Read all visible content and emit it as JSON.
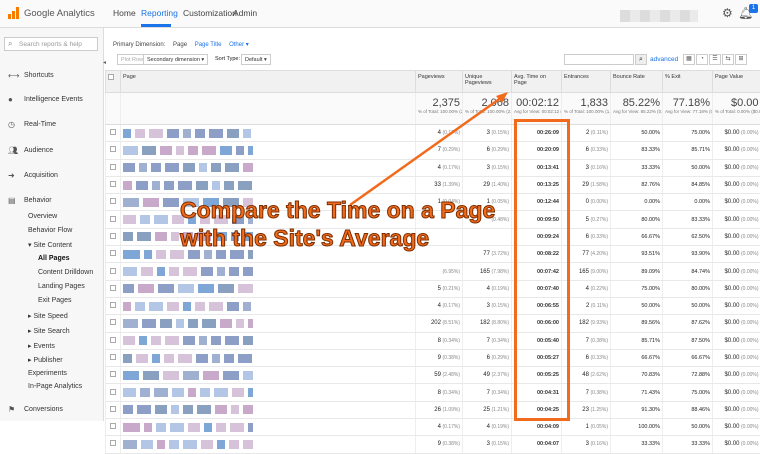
{
  "topbar": {
    "app_name": "Google Analytics",
    "tabs": [
      "Home",
      "Reporting",
      "Customization",
      "Admin"
    ],
    "active_tab": "Reporting",
    "notification_count": "1"
  },
  "sidebar": {
    "search_placeholder": "Search reports & help",
    "items": [
      {
        "label": "Shortcuts",
        "icon": "arrow-icon"
      },
      {
        "label": "Intelligence Events",
        "icon": "bulb-icon"
      },
      {
        "label": "Real-Time",
        "icon": "clock-icon"
      },
      {
        "label": "Audience",
        "icon": "people-icon"
      },
      {
        "label": "Acquisition",
        "icon": "acquisition-icon"
      },
      {
        "label": "Behavior",
        "icon": "behavior-icon"
      }
    ],
    "behavior_sub": [
      "Overview",
      "Behavior Flow",
      "▾ Site Content",
      "All Pages",
      "Content Drilldown",
      "Landing Pages",
      "Exit Pages",
      "▸ Site Speed",
      "▸ Site Search",
      "▸ Events",
      "▸ Publisher",
      "Experiments",
      "In-Page Analytics"
    ],
    "conversions": "Conversions"
  },
  "main": {
    "primary_dimension_label": "Primary Dimension:",
    "dim_page": "Page",
    "dim_page_title": "Page Title",
    "dim_other": "Other ▾",
    "plot_rows": "Plot Rows",
    "secondary_dimension": "Secondary dimension ▾",
    "sort_type_label": "Sort Type:",
    "sort_type": "Default ▾",
    "advanced": "advanced",
    "columns": [
      "",
      "Page",
      "Pageviews",
      "Unique Pageviews",
      "Avg. Time on Page",
      "Entrances",
      "Bounce Rate",
      "% Exit",
      "Page Value"
    ],
    "totals": {
      "pageviews": "2,375",
      "pageviews_sub": "% of Total: 100.00% (2,375)",
      "unique": "2,068",
      "unique_sub": "% of Total: 100.00% (2,068)",
      "avg_time": "00:02:12",
      "avg_time_sub": "Avg for View: 00:02:12 (0.00%)",
      "entrances": "1,833",
      "entrances_sub": "% of Total: 100.00% (1,833)",
      "bounce": "85.22%",
      "bounce_sub": "Avg for View: 85.22% (0.00%)",
      "exit": "77.18%",
      "exit_sub": "Avg for View: 77.18% (0.00%)",
      "value": "$0.00",
      "value_sub": "% of Total: 0.00% ($0.00)"
    },
    "rows": [
      {
        "pv": "4",
        "pvp": "(0.17%)",
        "u": "3",
        "up": "(0.15%)",
        "t": "00:26:09",
        "e": "2",
        "ep": "(0.11%)",
        "b": "50.00%",
        "x": "75.00%",
        "v": "$0.00",
        "vp": "(0.00%)"
      },
      {
        "pv": "7",
        "pvp": "(0.29%)",
        "u": "6",
        "up": "(0.29%)",
        "t": "00:20:09",
        "e": "6",
        "ep": "(0.33%)",
        "b": "83.33%",
        "x": "85.71%",
        "v": "$0.00",
        "vp": "(0.00%)"
      },
      {
        "pv": "4",
        "pvp": "(0.17%)",
        "u": "3",
        "up": "(0.15%)",
        "t": "00:13:41",
        "e": "3",
        "ep": "(0.16%)",
        "b": "33.33%",
        "x": "50.00%",
        "v": "$0.00",
        "vp": "(0.00%)"
      },
      {
        "pv": "33",
        "pvp": "(1.39%)",
        "u": "29",
        "up": "(1.40%)",
        "t": "00:13:25",
        "e": "29",
        "ep": "(1.58%)",
        "b": "82.76%",
        "x": "84.85%",
        "v": "$0.00",
        "vp": "(0.00%)"
      },
      {
        "pv": "1",
        "pvp": "(0.04%)",
        "u": "1",
        "up": "(0.05%)",
        "t": "00:12:44",
        "e": "0",
        "ep": "(0.00%)",
        "b": "0.00%",
        "x": "0.00%",
        "v": "$0.00",
        "vp": "(0.00%)"
      },
      {
        "pv": "",
        "pvp": "",
        "u": "",
        "up": "(0.48%)",
        "t": "00:09:50",
        "e": "5",
        "ep": "(0.27%)",
        "b": "80.00%",
        "x": "83.33%",
        "v": "$0.00",
        "vp": "(0.00%)"
      },
      {
        "pv": "",
        "pvp": "",
        "u": "",
        "up": "",
        "t": "00:09:24",
        "e": "6",
        "ep": "(0.33%)",
        "b": "66.67%",
        "x": "62.50%",
        "v": "$0.00",
        "vp": "(0.00%)"
      },
      {
        "pv": "",
        "pvp": "",
        "u": "77",
        "up": "(3.72%)",
        "t": "00:08:22",
        "e": "77",
        "ep": "(4.20%)",
        "b": "93.51%",
        "x": "93.90%",
        "v": "$0.00",
        "vp": "(0.00%)"
      },
      {
        "pv": "",
        "pvp": "(6.95%)",
        "u": "165",
        "up": "(7.98%)",
        "t": "00:07:42",
        "e": "165",
        "ep": "(9.00%)",
        "b": "89.09%",
        "x": "84.74%",
        "v": "$0.00",
        "vp": "(0.00%)"
      },
      {
        "pv": "5",
        "pvp": "(0.21%)",
        "u": "4",
        "up": "(0.19%)",
        "t": "00:07:40",
        "e": "4",
        "ep": "(0.22%)",
        "b": "75.00%",
        "x": "80.00%",
        "v": "$0.00",
        "vp": "(0.00%)"
      },
      {
        "pv": "4",
        "pvp": "(0.17%)",
        "u": "3",
        "up": "(0.15%)",
        "t": "00:06:55",
        "e": "2",
        "ep": "(0.11%)",
        "b": "50.00%",
        "x": "50.00%",
        "v": "$0.00",
        "vp": "(0.00%)"
      },
      {
        "pv": "202",
        "pvp": "(8.51%)",
        "u": "182",
        "up": "(8.80%)",
        "t": "00:06:00",
        "e": "182",
        "ep": "(9.93%)",
        "b": "89.56%",
        "x": "87.62%",
        "v": "$0.00",
        "vp": "(0.00%)"
      },
      {
        "pv": "8",
        "pvp": "(0.34%)",
        "u": "7",
        "up": "(0.34%)",
        "t": "00:05:40",
        "e": "7",
        "ep": "(0.38%)",
        "b": "85.71%",
        "x": "87.50%",
        "v": "$0.00",
        "vp": "(0.00%)"
      },
      {
        "pv": "9",
        "pvp": "(0.38%)",
        "u": "6",
        "up": "(0.29%)",
        "t": "00:05:27",
        "e": "6",
        "ep": "(0.33%)",
        "b": "66.67%",
        "x": "66.67%",
        "v": "$0.00",
        "vp": "(0.00%)"
      },
      {
        "pv": "59",
        "pvp": "(2.48%)",
        "u": "49",
        "up": "(2.37%)",
        "t": "00:05:25",
        "e": "48",
        "ep": "(2.62%)",
        "b": "70.83%",
        "x": "72.88%",
        "v": "$0.00",
        "vp": "(0.00%)"
      },
      {
        "pv": "8",
        "pvp": "(0.34%)",
        "u": "7",
        "up": "(0.34%)",
        "t": "00:04:31",
        "e": "7",
        "ep": "(0.38%)",
        "b": "71.43%",
        "x": "75.00%",
        "v": "$0.00",
        "vp": "(0.00%)"
      },
      {
        "pv": "26",
        "pvp": "(1.09%)",
        "u": "25",
        "up": "(1.21%)",
        "t": "00:04:25",
        "e": "23",
        "ep": "(1.25%)",
        "b": "91.30%",
        "x": "88.46%",
        "v": "$0.00",
        "vp": "(0.00%)"
      },
      {
        "pv": "4",
        "pvp": "(0.17%)",
        "u": "4",
        "up": "(0.19%)",
        "t": "00:04:09",
        "e": "1",
        "ep": "(0.05%)",
        "b": "100.00%",
        "x": "50.00%",
        "v": "$0.00",
        "vp": "(0.00%)"
      },
      {
        "pv": "9",
        "pvp": "(0.38%)",
        "u": "3",
        "up": "(0.15%)",
        "t": "00:04:07",
        "e": "3",
        "ep": "(0.16%)",
        "b": "33.33%",
        "x": "33.33%",
        "v": "$0.00",
        "vp": "(0.00%)"
      }
    ]
  },
  "annotation": {
    "line1": "Compare the Time on a Page",
    "line2": "with the Site's Average",
    "color": "#f26a1b"
  }
}
